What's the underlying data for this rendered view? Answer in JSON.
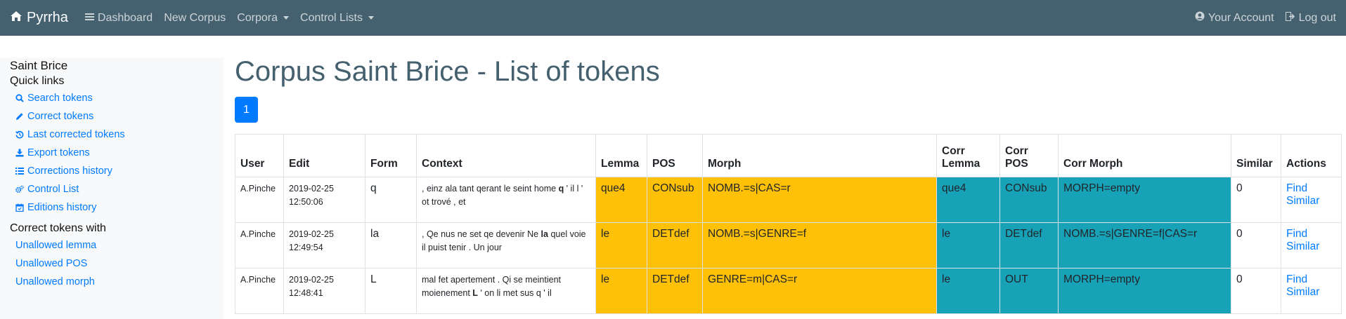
{
  "navbar": {
    "brand": "Pyrrha",
    "items": [
      "Dashboard",
      "New Corpus",
      "Corpora",
      "Control Lists"
    ],
    "account": "Your Account",
    "logout": "Log out"
  },
  "sidebar": {
    "corpus_name": "Saint Brice",
    "quick_links_title": "Quick links",
    "quick_links": [
      {
        "label": "Search tokens",
        "icon": "search-icon"
      },
      {
        "label": "Correct tokens",
        "icon": "pencil-icon"
      },
      {
        "label": "Last corrected tokens",
        "icon": "history-icon"
      },
      {
        "label": "Export tokens",
        "icon": "download-icon"
      },
      {
        "label": "Corrections history",
        "icon": "list-icon"
      },
      {
        "label": "Control List",
        "icon": "cogs-icon"
      },
      {
        "label": "Editions history",
        "icon": "calendar-icon"
      }
    ],
    "correct_with_title": "Correct tokens with",
    "correct_with": [
      "Unallowed lemma",
      "Unallowed POS",
      "Unallowed morph"
    ]
  },
  "main": {
    "title": "Corpus Saint Brice - List of tokens",
    "page": "1"
  },
  "table": {
    "headers": [
      "User",
      "Edit",
      "Form",
      "Context",
      "Lemma",
      "POS",
      "Morph",
      "Corr Lemma",
      "Corr POS",
      "Corr Morph",
      "Similar",
      "Actions"
    ],
    "rows": [
      {
        "user": "A.Pinche",
        "date": "2019-02-25",
        "time": "12:50:06",
        "form": "q",
        "ctx_before": ", einz ala tant qerant le seint home ",
        "ctx_token": "q",
        "ctx_after": " ' il l ' ot trové , et",
        "lemma": "que4",
        "pos": "CONsub",
        "morph": "NOMB.=s|CAS=r",
        "corr_lemma": "que4",
        "corr_pos": "CONsub",
        "corr_morph": "MORPH=empty",
        "similar": "0",
        "action": "Find Similar"
      },
      {
        "user": "A.Pinche",
        "date": "2019-02-25",
        "time": "12:49:54",
        "form": "la",
        "ctx_before": ", Qe nus ne set qe devenir Ne ",
        "ctx_token": "la",
        "ctx_after": " quel voie il puist tenir . Un jour",
        "lemma": "le",
        "pos": "DETdef",
        "morph": "NOMB.=s|GENRE=f",
        "corr_lemma": "le",
        "corr_pos": "DETdef",
        "corr_morph": "NOMB.=s|GENRE=f|CAS=r",
        "similar": "0",
        "action": "Find Similar"
      },
      {
        "user": "A.Pinche",
        "date": "2019-02-25",
        "time": "12:48:41",
        "form": "L",
        "ctx_before": "mal fet apertement . Qi se meintient moienement ",
        "ctx_token": "L",
        "ctx_after": " ' on li met sus q ' il",
        "lemma": "le",
        "pos": "DETdef",
        "morph": "GENRE=m|CAS=r",
        "corr_lemma": "le",
        "corr_pos": "OUT",
        "corr_morph": "MORPH=empty",
        "similar": "0",
        "action": "Find Similar"
      }
    ]
  },
  "colors": {
    "navbar": "#45606f",
    "accent": "#007bff",
    "changed": "#ffc107",
    "corrected": "#17a2b8"
  }
}
